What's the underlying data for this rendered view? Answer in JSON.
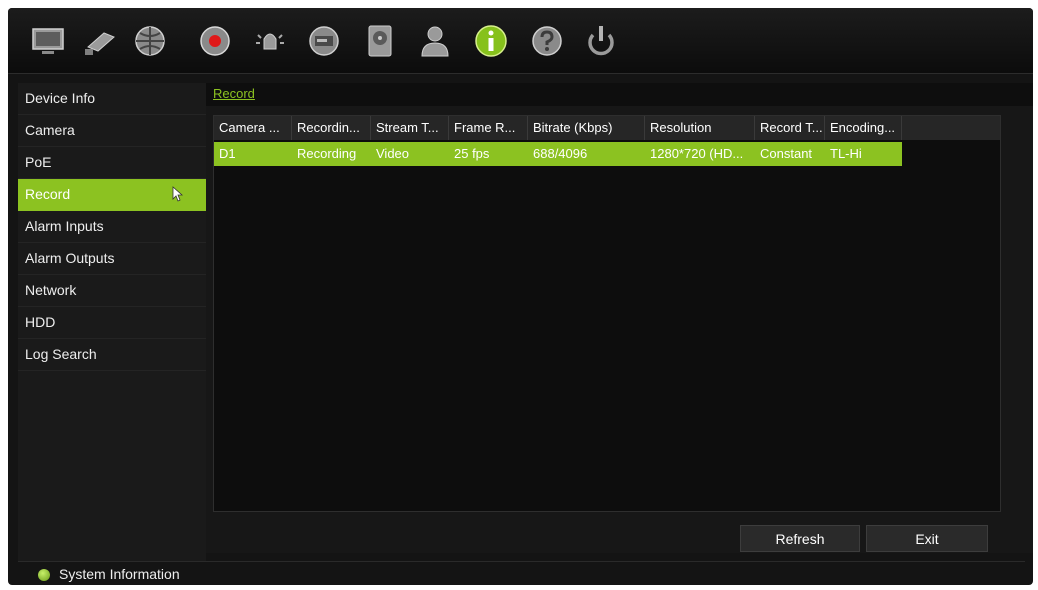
{
  "toolbar": {
    "icons": [
      {
        "name": "display-icon"
      },
      {
        "name": "camera-icon"
      },
      {
        "name": "network-icon"
      },
      {
        "name": "record-icon"
      },
      {
        "name": "alarm-icon"
      },
      {
        "name": "device-icon"
      },
      {
        "name": "hdd-icon"
      },
      {
        "name": "user-icon"
      },
      {
        "name": "info-icon",
        "active": true
      },
      {
        "name": "help-icon"
      },
      {
        "name": "power-icon"
      }
    ]
  },
  "sidebar": {
    "items": [
      {
        "label": "Device Info"
      },
      {
        "label": "Camera"
      },
      {
        "label": "PoE"
      },
      {
        "label": "Record",
        "active": true
      },
      {
        "label": "Alarm Inputs"
      },
      {
        "label": "Alarm Outputs"
      },
      {
        "label": "Network"
      },
      {
        "label": "HDD"
      },
      {
        "label": "Log Search"
      }
    ]
  },
  "main": {
    "breadcrumb": "Record",
    "table": {
      "columns": [
        "Camera ...",
        "Recordin...",
        "Stream T...",
        "Frame R...",
        "Bitrate (Kbps)",
        "Resolution",
        "Record T...",
        "Encoding..."
      ],
      "rows": [
        [
          "D1",
          "Recording",
          "Video",
          "25 fps",
          "688/4096",
          "1280*720 (HD...",
          "Constant",
          "TL-Hi"
        ]
      ]
    },
    "buttons": {
      "refresh": "Refresh",
      "exit": "Exit"
    }
  },
  "statusbar": {
    "text": "System Information"
  },
  "colors": {
    "accent": "#8cc221",
    "background": "#141414"
  }
}
